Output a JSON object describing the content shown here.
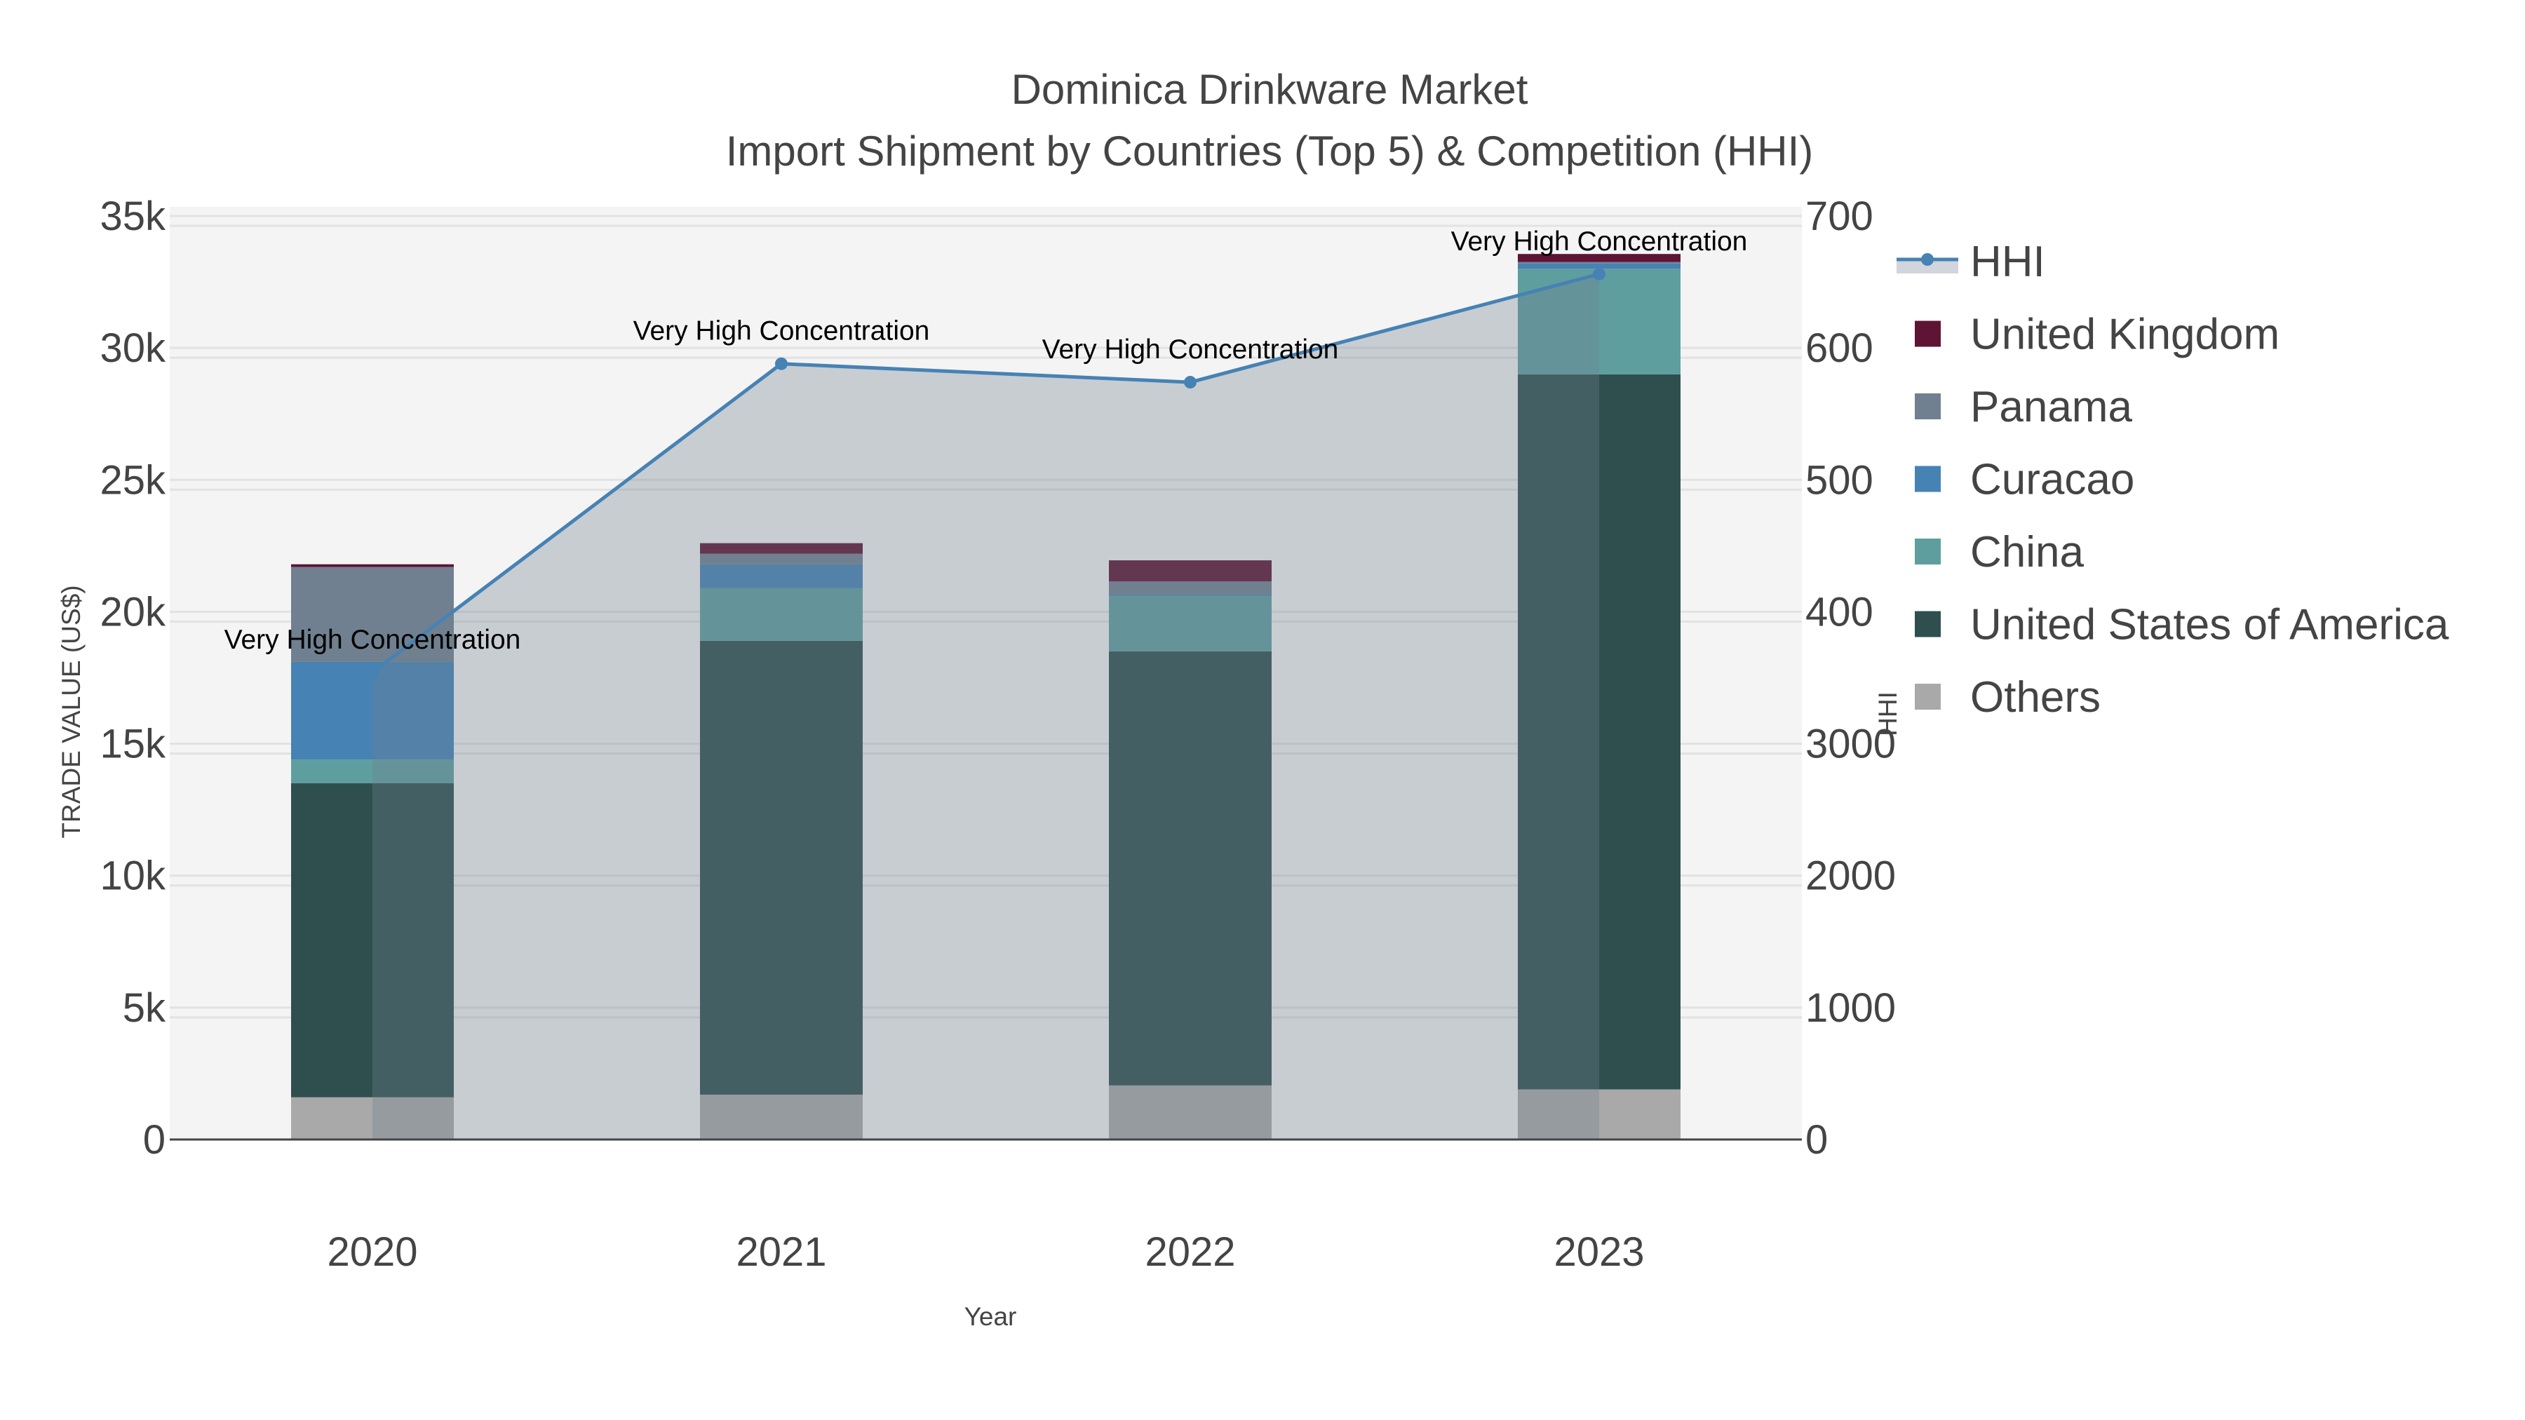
{
  "chart_data": {
    "type": "bar",
    "title": "Dominica Drinkware Market",
    "subtitle": "Import Shipment by Countries (Top 5) & Competition (HHI)",
    "xlabel": "Year",
    "ylabel": "TRADE VALUE (US$)",
    "y2label": "HHI",
    "categories": [
      "2020",
      "2021",
      "2022",
      "2023"
    ],
    "ylim": [
      0,
      35000
    ],
    "y2lim": [
      0,
      7000
    ],
    "yticks": [
      {
        "v": 0,
        "label": "0"
      },
      {
        "v": 5000,
        "label": "5k"
      },
      {
        "v": 10000,
        "label": "10k"
      },
      {
        "v": 15000,
        "label": "15k"
      },
      {
        "v": 20000,
        "label": "20k"
      },
      {
        "v": 25000,
        "label": "25k"
      },
      {
        "v": 30000,
        "label": "30k"
      },
      {
        "v": 35000,
        "label": "35k"
      }
    ],
    "y2ticks": [
      {
        "v": 0,
        "label": "0"
      },
      {
        "v": 1000,
        "label": "1000"
      },
      {
        "v": 2000,
        "label": "2000"
      },
      {
        "v": 3000,
        "label": "3000"
      },
      {
        "v": 4000,
        "label": "400"
      },
      {
        "v": 5000,
        "label": "500"
      },
      {
        "v": 6000,
        "label": "600"
      },
      {
        "v": 7000,
        "label": "700"
      }
    ],
    "grid": true,
    "legend_position": "right",
    "series": [
      {
        "name": "Others",
        "color": "#a9a9a9",
        "values": [
          1600,
          1700,
          2050,
          1900
        ]
      },
      {
        "name": "United States of America",
        "color": "#2f4f4f",
        "values": [
          11900,
          17200,
          16450,
          27100
        ]
      },
      {
        "name": "China",
        "color": "#5f9e9e",
        "values": [
          900,
          2000,
          2100,
          4000
        ]
      },
      {
        "name": "Curacao",
        "color": "#4682b4",
        "values": [
          3700,
          900,
          50,
          200
        ]
      },
      {
        "name": "Panama",
        "color": "#708090",
        "values": [
          3600,
          400,
          500,
          60
        ]
      },
      {
        "name": "United Kingdom",
        "color": "#5e1434",
        "values": [
          100,
          400,
          800,
          300
        ]
      }
    ],
    "hhi": {
      "name": "HHI",
      "color": "#4682b4",
      "fill": "rgba(112,128,144,0.33)",
      "values": [
        3540,
        5880,
        5740,
        6560
      ],
      "annotations": [
        "Very High Concentration",
        "Very High Concentration",
        "Very High Concentration",
        "Very High Concentration"
      ]
    },
    "legend_order": [
      "HHI",
      "United Kingdom",
      "Panama",
      "Curacao",
      "China",
      "United States of America",
      "Others"
    ]
  }
}
